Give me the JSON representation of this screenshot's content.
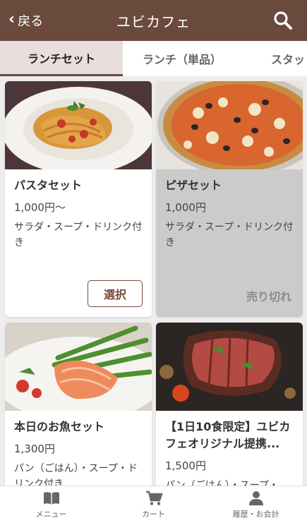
{
  "header": {
    "back_label": "戻る",
    "title": "ユビカフェ",
    "bg_color": "#6b4a3e"
  },
  "tabs": [
    {
      "label": "ランチセット",
      "active": true
    },
    {
      "label": "ランチ（単品）",
      "active": false
    },
    {
      "label": "スタッ",
      "active": false
    }
  ],
  "menu_items": [
    {
      "name": "パスタセット",
      "price": "1,000円〜",
      "description": "サラダ・スープ・ドリンク付き",
      "action": "選択",
      "sold_out": false
    },
    {
      "name": "ピザセット",
      "price": "1,000円",
      "description": "サラダ・スープ・ドリンク付き",
      "action": "売り切れ",
      "sold_out": true
    },
    {
      "name": "本日のお魚セット",
      "price": "1,300円",
      "description": "パン（ごはん）・スープ・ドリンク付き",
      "action": "",
      "sold_out": false
    },
    {
      "name": "【1日10食限定】ユビカフェオリジナル提携...",
      "price": "1,500円",
      "description": "パン（ごはん）・スープ・",
      "action": "",
      "sold_out": false
    }
  ],
  "bottom_nav": [
    {
      "label": "メニュー",
      "icon": "book-icon"
    },
    {
      "label": "カート",
      "icon": "cart-icon"
    },
    {
      "label": "履歴・お会計",
      "icon": "person-icon"
    }
  ]
}
